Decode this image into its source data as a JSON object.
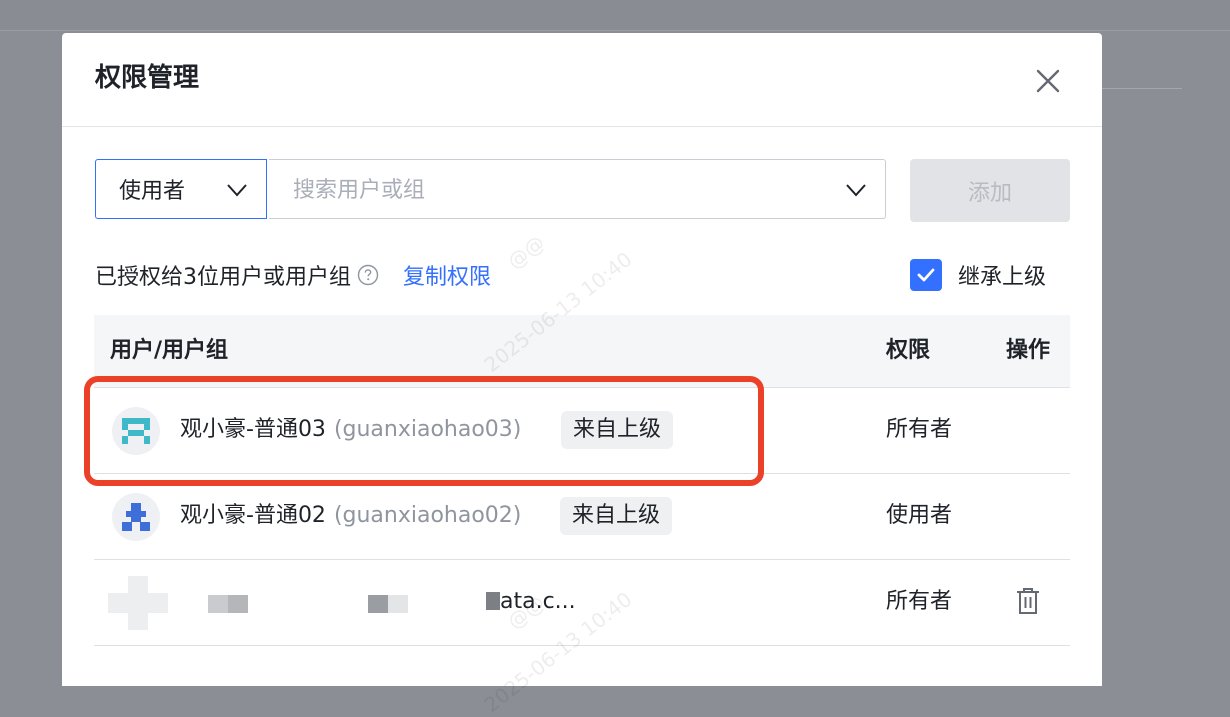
{
  "dialog": {
    "title": "权限管理",
    "role_select": {
      "value": "使用者"
    },
    "search": {
      "placeholder": "搜索用户或组"
    },
    "add_label": "添加",
    "granted_text": "已授权给3位用户或用户组",
    "copy_link": "复制权限",
    "inherit": {
      "label": "继承上级",
      "checked": true
    }
  },
  "table": {
    "headers": {
      "user": "用户/用户组",
      "permission": "权限",
      "action": "操作"
    },
    "rows": [
      {
        "name": "观小豪-普通03",
        "id": "(guanxiaohao03)",
        "tag": "来自上级",
        "permission": "所有者",
        "avatar": "pixel-avatar-teal"
      },
      {
        "name": "观小豪-普通02",
        "id": "(guanxiaohao02)",
        "tag": "来自上级",
        "permission": "使用者",
        "avatar": "pixel-avatar-blue"
      },
      {
        "name_fragment": "ata.c...",
        "permission": "所有者",
        "action_icon": "trash-icon",
        "note": "redacted-row"
      }
    ]
  },
  "watermark": {
    "handle": "@@",
    "datetime": "2025-06-13 10:40"
  },
  "colors": {
    "primary": "#3370ff",
    "highlight": "#ea4128",
    "overlay": "#8b8e95"
  }
}
